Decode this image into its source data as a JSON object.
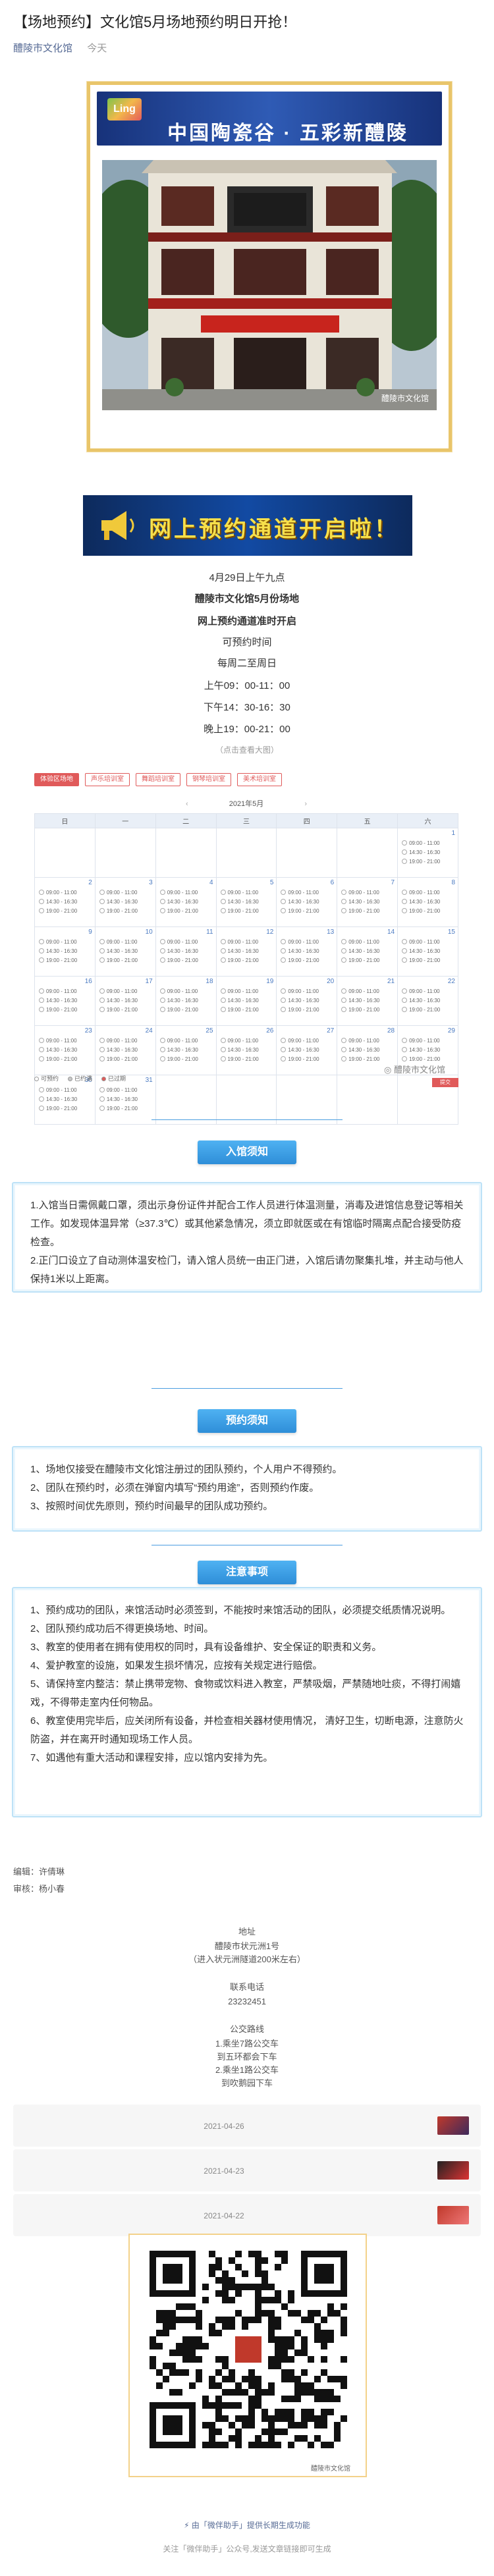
{
  "article": {
    "title": "【场地预约】文化馆5月场地预约明日开抢！",
    "account": "醴陵市文化馆",
    "date": "今天"
  },
  "poster": {
    "logo_text": "Ling",
    "banner_text": "中国陶瓷谷 · 五彩新醴陵",
    "watermark": "醴陵市文化馆",
    "promo_text": "网上预约通道开启啦！"
  },
  "info": {
    "time": "4月29日上午九点",
    "venue": "醴陵市文化馆5月份场地",
    "channel": "网上预约通道准时开启",
    "bookable_label": "可预约时间",
    "days": "每周二至周日",
    "slot_am": "上午09：00-11：00",
    "slot_pm": "下午14：30-16：30",
    "slot_eve": "晚上19：00-21：00",
    "hint": "（点击查看大图）"
  },
  "calendar": {
    "tabs": [
      "体验区场地",
      "声乐培训室",
      "舞蹈培训室",
      "钢琴培训室",
      "美术培训室"
    ],
    "month": "2021年5月",
    "weekdays": [
      "日",
      "一",
      "二",
      "三",
      "四",
      "五",
      "六"
    ],
    "slot_labels": [
      "09:00 - 11:00",
      "14:30 - 16:30",
      "19:00 - 21:00"
    ],
    "legend": [
      "可预约",
      "已约满",
      "已过期"
    ],
    "watermark": "醴陵市文化馆",
    "submit": "提交",
    "weeks": [
      [
        null,
        null,
        null,
        null,
        null,
        null,
        "1"
      ],
      [
        "2",
        "3",
        "4",
        "5",
        "6",
        "7",
        "8"
      ],
      [
        "9",
        "10",
        "11",
        "12",
        "13",
        "14",
        "15"
      ],
      [
        "16",
        "17",
        "18",
        "19",
        "20",
        "21",
        "22"
      ],
      [
        "23",
        "24",
        "25",
        "26",
        "27",
        "28",
        "29"
      ],
      [
        "30",
        "31",
        null,
        null,
        null,
        null,
        null
      ]
    ]
  },
  "sections": {
    "entry": {
      "title": "入馆须知",
      "paras": [
        "1.入馆当日需佩戴口罩，须出示身份证件并配合工作人员进行体温测量，消毒及进馆信息登记等相关工作。如发现体温异常（≥37.3℃）或其他紧急情况，须立即就医或在有馆临时隔离点配合接受防疫检查。",
        "2.正门口设立了自动测体温安检门，请入馆人员统一由正门进，入馆后请勿聚集扎堆，并主动与他人保持1米以上距离。"
      ]
    },
    "booking": {
      "title": "预约须知",
      "paras": [
        "1、场地仅接受在醴陵市文化馆注册过的团队预约，个人用户不得预约。",
        "2、团队在预约时，必须在弹窗内填写“预约用途”，否则预约作废。",
        "3、按照时间优先原则，预约时间最早的团队成功预约。"
      ]
    },
    "notes": {
      "title": "注意事项",
      "paras": [
        "1、预约成功的团队，来馆活动时必须签到，不能按时来馆活动的团队，必须提交纸质情况说明。",
        "2、团队预约成功后不得更换场地、时间。",
        "3、教室的使用者在拥有使用权的同时，具有设备维护、安全保证的职责和义务。",
        "4、爱护教室的设施，如果发生损坏情况，应按有关规定进行赔偿。",
        "5、请保持室内整洁：禁止携带宠物、食物或饮料进入教室，严禁吸烟，严禁随地吐痰，不得打闹嬉戏，不得带走室内任何物品。",
        "6、教室使用完毕后，应关闭所有设备，并检查相关器材使用情况， 清好卫生，切断电源，注意防火防盗，并在离开时通知现场工作人员。",
        "7、如遇他有重大活动和课程安排，应以馆内安排为先。"
      ]
    }
  },
  "credits": {
    "editor": "编辑：许倩琳",
    "reviewer": "审核：杨小春"
  },
  "contact": {
    "addr_label": "地址",
    "addr_line1": "醴陵市状元洲1号",
    "addr_line2": "（进入状元洲隧道200米左右）",
    "phone_label": "联系电话",
    "phone": "23232451",
    "bus_label": "公交路线",
    "bus1": "1.乘坐7路公交车",
    "bus1_stop": "到五环都会下车",
    "bus2": "2.乘坐1路公交车",
    "bus2_stop": "到吹鹅园下车"
  },
  "related": [
    {
      "date": "2021-04-26"
    },
    {
      "date": "2021-04-23"
    },
    {
      "date": "2021-04-22"
    }
  ],
  "qr": {
    "label": "醴陵市文化馆"
  },
  "footer": {
    "line1": "由「微伴助手」提供长期生成功能",
    "line2": "关注「微伴助手」公众号,发送文章链接即可生成",
    "accent": "#576b95"
  }
}
